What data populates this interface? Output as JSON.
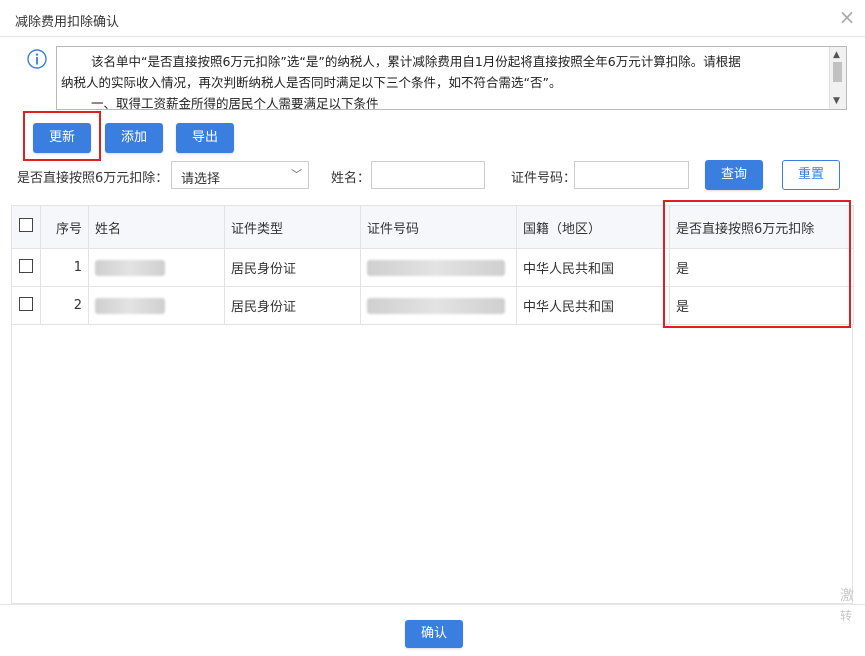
{
  "dialog": {
    "title": "减除费用扣除确认",
    "close_icon": "×"
  },
  "notice": {
    "line1": "该名单中“是否直接按照6万元扣除”选“是”的纳税人，累计减除费用自1月份起将直接按照全年6万元计算扣除。请根据",
    "line2": "纳税人的实际收入情况，再次判断纳税人是否同时满足以下三个条件，如不符合需选“否”。",
    "line3": "一、取得工资薪金所得的居民个人需要满足以下条件"
  },
  "toolbar": {
    "update_label": "更新",
    "add_label": "添加",
    "export_label": "导出"
  },
  "filters": {
    "direct_label": "是否直接按照6万元扣除：",
    "direct_value": "请选择",
    "name_label": "姓名：",
    "name_value": "",
    "id_label": "证件号码：",
    "id_value": "",
    "query_label": "查询",
    "reset_label": "重置"
  },
  "table": {
    "headers": [
      "序号",
      "姓名",
      "证件类型",
      "证件号码",
      "国籍（地区）",
      "是否直接按照6万元扣除"
    ],
    "rows": [
      {
        "no": "1",
        "id_type": "居民身份证",
        "nationality": "中华人民共和国",
        "direct": "是"
      },
      {
        "no": "2",
        "id_type": "居民身份证",
        "nationality": "中华人民共和国",
        "direct": "是"
      }
    ]
  },
  "footer": {
    "confirm_label": "确认"
  },
  "watermark": {
    "line1": "激",
    "line2": "转"
  },
  "colors": {
    "accent": "#3a7ee0",
    "highlight": "#e02020"
  }
}
